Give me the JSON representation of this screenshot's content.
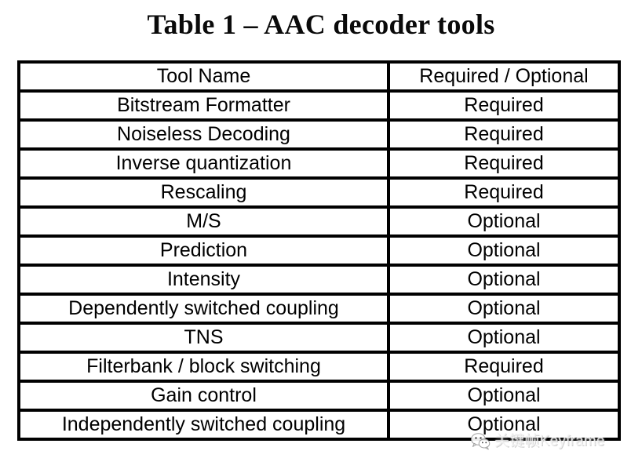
{
  "document": {
    "title": "Table 1 – AAC decoder tools",
    "background_color": "#ffffff",
    "text_color": "#000000",
    "border_color": "#000000"
  },
  "table": {
    "columns": [
      {
        "key": "tool",
        "header": "Tool Name"
      },
      {
        "key": "req",
        "header": "Required / Optional"
      }
    ],
    "rows": [
      {
        "tool": "Bitstream Formatter",
        "req": "Required"
      },
      {
        "tool": "Noiseless Decoding",
        "req": "Required"
      },
      {
        "tool": "Inverse quantization",
        "req": "Required"
      },
      {
        "tool": "Rescaling",
        "req": "Required"
      },
      {
        "tool": "M/S",
        "req": "Optional"
      },
      {
        "tool": "Prediction",
        "req": "Optional"
      },
      {
        "tool": "Intensity",
        "req": "Optional"
      },
      {
        "tool": "Dependently switched coupling",
        "req": "Optional"
      },
      {
        "tool": "TNS",
        "req": "Optional"
      },
      {
        "tool": "Filterbank / block switching",
        "req": "Required"
      },
      {
        "tool": "Gain control",
        "req": "Optional"
      },
      {
        "tool": "Independently switched coupling",
        "req": "Optional"
      }
    ]
  },
  "watermark": {
    "text": "关键帧Keyframe",
    "icon": "wechat-speech-bubble-icon",
    "color": "#f2f2f2"
  }
}
